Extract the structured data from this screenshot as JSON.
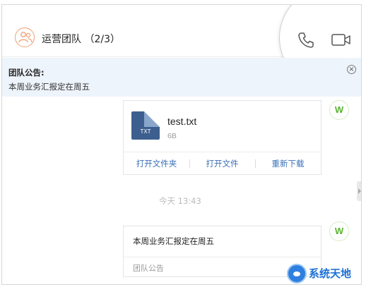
{
  "header": {
    "team_name": "运营团队",
    "member_count": "(2/3)",
    "title_full": "运营团队 （2/3）",
    "avatar_icon": "team-icon",
    "actions": [
      {
        "icon": "phone-icon"
      },
      {
        "icon": "video-camera-icon"
      }
    ]
  },
  "announcement": {
    "title": "团队公告:",
    "text": "本周业务汇报定在周五",
    "close_icon": "close-circle-icon",
    "close_glyph": "×"
  },
  "file_message": {
    "file_name": "test.txt",
    "file_size": "6B",
    "file_type_label": "TXT",
    "actions": [
      "打开文件夹",
      "打开文件",
      "重新下载"
    ],
    "sender_avatar_letter": "W"
  },
  "timestamp": "今天 13:43",
  "notice_message": {
    "text": "本周业务汇报定在周五",
    "label": "团队公告",
    "sender_avatar_letter": "W"
  },
  "watermark": {
    "text": "系统天地"
  },
  "colors": {
    "accent": "#3b6fb6",
    "notice_bg": "#eef4fb",
    "avatar_green": "#58b52d",
    "file_icon": "#3d5f8f"
  }
}
